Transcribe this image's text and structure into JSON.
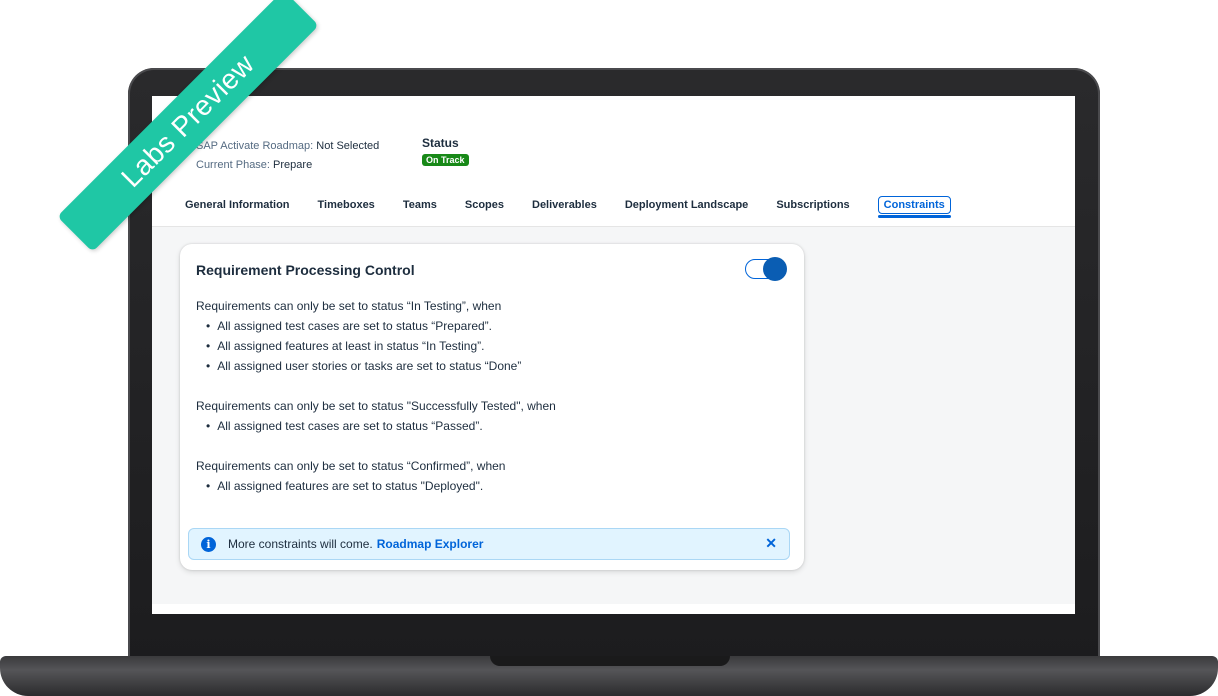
{
  "header": {
    "roadmap_label": "SAP Activate Roadmap:",
    "roadmap_value": "Not Selected",
    "phase_label": "Current Phase:",
    "phase_value": "Prepare",
    "status_title": "Status",
    "status_badge": "On Track"
  },
  "tabs": [
    {
      "label": "General Information"
    },
    {
      "label": "Timeboxes"
    },
    {
      "label": "Teams"
    },
    {
      "label": "Scopes"
    },
    {
      "label": "Deliverables"
    },
    {
      "label": "Deployment Landscape"
    },
    {
      "label": "Subscriptions"
    },
    {
      "label": "Constraints",
      "active": true
    }
  ],
  "card": {
    "title": "Requirement Processing Control",
    "toggle_on": true,
    "rules": [
      {
        "intro": "Requirements can only be set to status “In Testing”, when",
        "items": [
          "All assigned test cases are set to status “Prepared”.",
          "All assigned features at least in status “In Testing”.",
          "All assigned user stories or tasks are set to status “Done”"
        ]
      },
      {
        "intro": "Requirements can only be set to status \"Successfully Tested\", when",
        "items": [
          "All assigned test cases are set to status “Passed”."
        ]
      },
      {
        "intro": "Requirements can only be set to status “Confirmed”, when",
        "items": [
          "All assigned features are set to status \"Deployed\"."
        ]
      }
    ]
  },
  "info": {
    "text": "More constraints will come.",
    "link": "Roadmap Explorer",
    "icon": "info-icon",
    "close_icon": "close-icon"
  },
  "ribbon": {
    "text": "Labs Preview"
  },
  "colors": {
    "accent": "#0064d9",
    "success": "#188918",
    "ribbon": "#1fc7a5"
  }
}
